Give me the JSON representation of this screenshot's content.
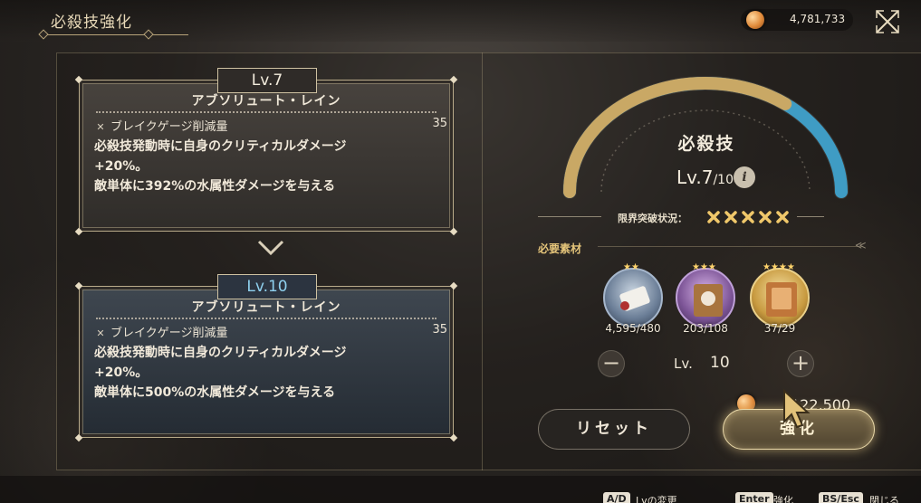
{
  "header": {
    "title": "必殺技強化",
    "currency_value": "4,781,733"
  },
  "cards": [
    {
      "level": "Lv.7",
      "skill_name": "アブソリュート・レイン",
      "stat_label": "ブレイクゲージ削減量",
      "stat_value": "35",
      "desc_lines": [
        "必殺技発動時に自身のクリティカルダメージ",
        "+20%。",
        "敵単体に392%の水属性ダメージを与える"
      ]
    },
    {
      "level": "Lv.10",
      "skill_name": "アブソリュート・レイン",
      "stat_label": "ブレイクゲージ削減量",
      "stat_value": "35",
      "desc_lines": [
        "必殺技発動時に自身のクリティカルダメージ",
        "+20%。",
        "敵単体に500%の水属性ダメージを与える"
      ]
    }
  ],
  "gauge": {
    "title": "必殺技",
    "level": "Lv.7",
    "max": "/10",
    "info": "i",
    "current_fraction": 0.7,
    "preview_fraction": 1.0,
    "colors": {
      "gold": "#c9a865",
      "blue": "#3f9cc4",
      "track": "#3a3632"
    }
  },
  "limit_break": {
    "label": "限界突破状況：",
    "count": 5
  },
  "materials": {
    "label": "必要素材",
    "items": [
      {
        "icon": "scroll-material-icon",
        "count": "4,595/480",
        "stars": "★★"
      },
      {
        "icon": "tome-material-icon",
        "count": "203/108",
        "stars": "★★★"
      },
      {
        "icon": "grimoire-material-icon",
        "count": "37/29",
        "stars": "★★★★"
      }
    ]
  },
  "stepper": {
    "minus": "−",
    "plus": "+",
    "label": "Lv.",
    "value": "10"
  },
  "cost": {
    "value": "122,500"
  },
  "buttons": {
    "reset": "リセット",
    "enhance": "強化"
  },
  "footer": {
    "keys": [
      {
        "key": "A/D",
        "label": "Lvの変更"
      },
      {
        "key": "Enter",
        "label": "強化"
      },
      {
        "key": "BS/Esc",
        "label": "閉じる"
      }
    ]
  }
}
